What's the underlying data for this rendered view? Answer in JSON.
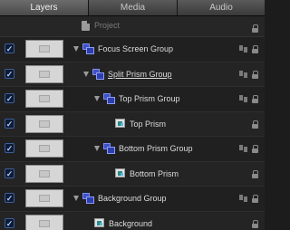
{
  "tabs": [
    {
      "label": "Layers",
      "active": true
    },
    {
      "label": "Media",
      "active": false
    },
    {
      "label": "Audio",
      "active": false
    }
  ],
  "project": {
    "label": "Project"
  },
  "layers": [
    {
      "label": "Focus Screen Group",
      "type": "group",
      "checked": true
    },
    {
      "label": "Split Prism Group",
      "type": "group",
      "checked": true
    },
    {
      "label": "Top Prism Group",
      "type": "group",
      "checked": true
    },
    {
      "label": "Top Prism",
      "type": "image",
      "checked": true
    },
    {
      "label": "Bottom Prism Group",
      "type": "group",
      "checked": true
    },
    {
      "label": "Bottom Prism",
      "type": "image",
      "checked": true
    },
    {
      "label": "Background Group",
      "type": "group",
      "checked": true
    },
    {
      "label": "Background",
      "type": "image",
      "checked": true
    }
  ],
  "colors": {
    "group_icon": "#3d52c8",
    "checkbox_border": "#3d5f9a",
    "panel_bg": "#1e1e1e"
  }
}
